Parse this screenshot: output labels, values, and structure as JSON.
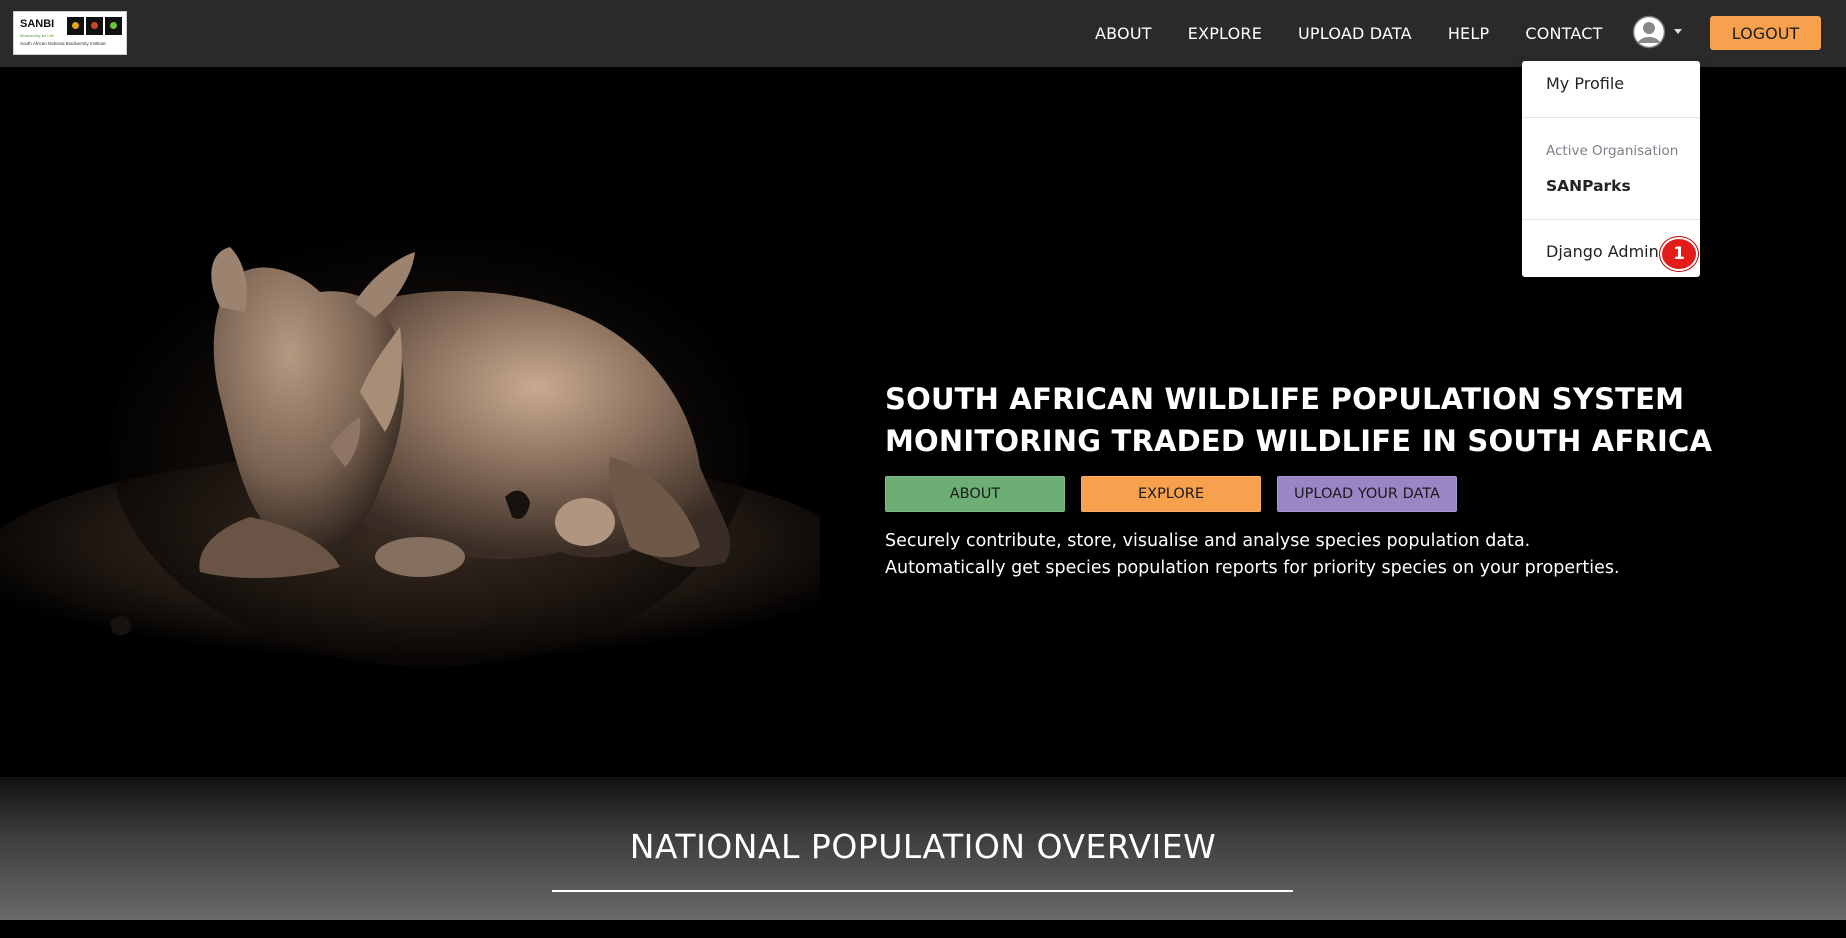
{
  "logo": {
    "name": "SANBI",
    "tagline": "Biodiversity for Life",
    "institute": "South African National Biodiversity Institute"
  },
  "nav": {
    "links": [
      "ABOUT",
      "EXPLORE",
      "UPLOAD DATA",
      "HELP",
      "CONTACT"
    ],
    "logout_label": "LOGOUT",
    "profile_icon": "user-circle-icon"
  },
  "dropdown": {
    "my_profile": "My Profile",
    "active_org_label": "Active Organisation",
    "active_org_value": "SANParks",
    "django_admin": "Django Admin",
    "badge_count": "1"
  },
  "hero": {
    "title_line1": "SOUTH AFRICAN WILDLIFE POPULATION SYSTEM",
    "title_line2": "MONITORING TRADED WILDLIFE IN SOUTH AFRICA",
    "buttons": {
      "about": "ABOUT",
      "explore": "EXPLORE",
      "upload": "UPLOAD YOUR DATA"
    },
    "desc_line1": "Securely contribute, store, visualise and analyse species population data.",
    "desc_line2": "Automatically get species population reports for priority species on your properties.",
    "image": "rhino-photo"
  },
  "overview": {
    "title": "NATIONAL POPULATION OVERVIEW"
  },
  "colors": {
    "navbar_bg": "#2a2a2a",
    "accent_orange": "#f7a04d",
    "accent_green": "#6cae74",
    "accent_purple": "#9b85c4",
    "badge_red": "#e31b1b"
  }
}
